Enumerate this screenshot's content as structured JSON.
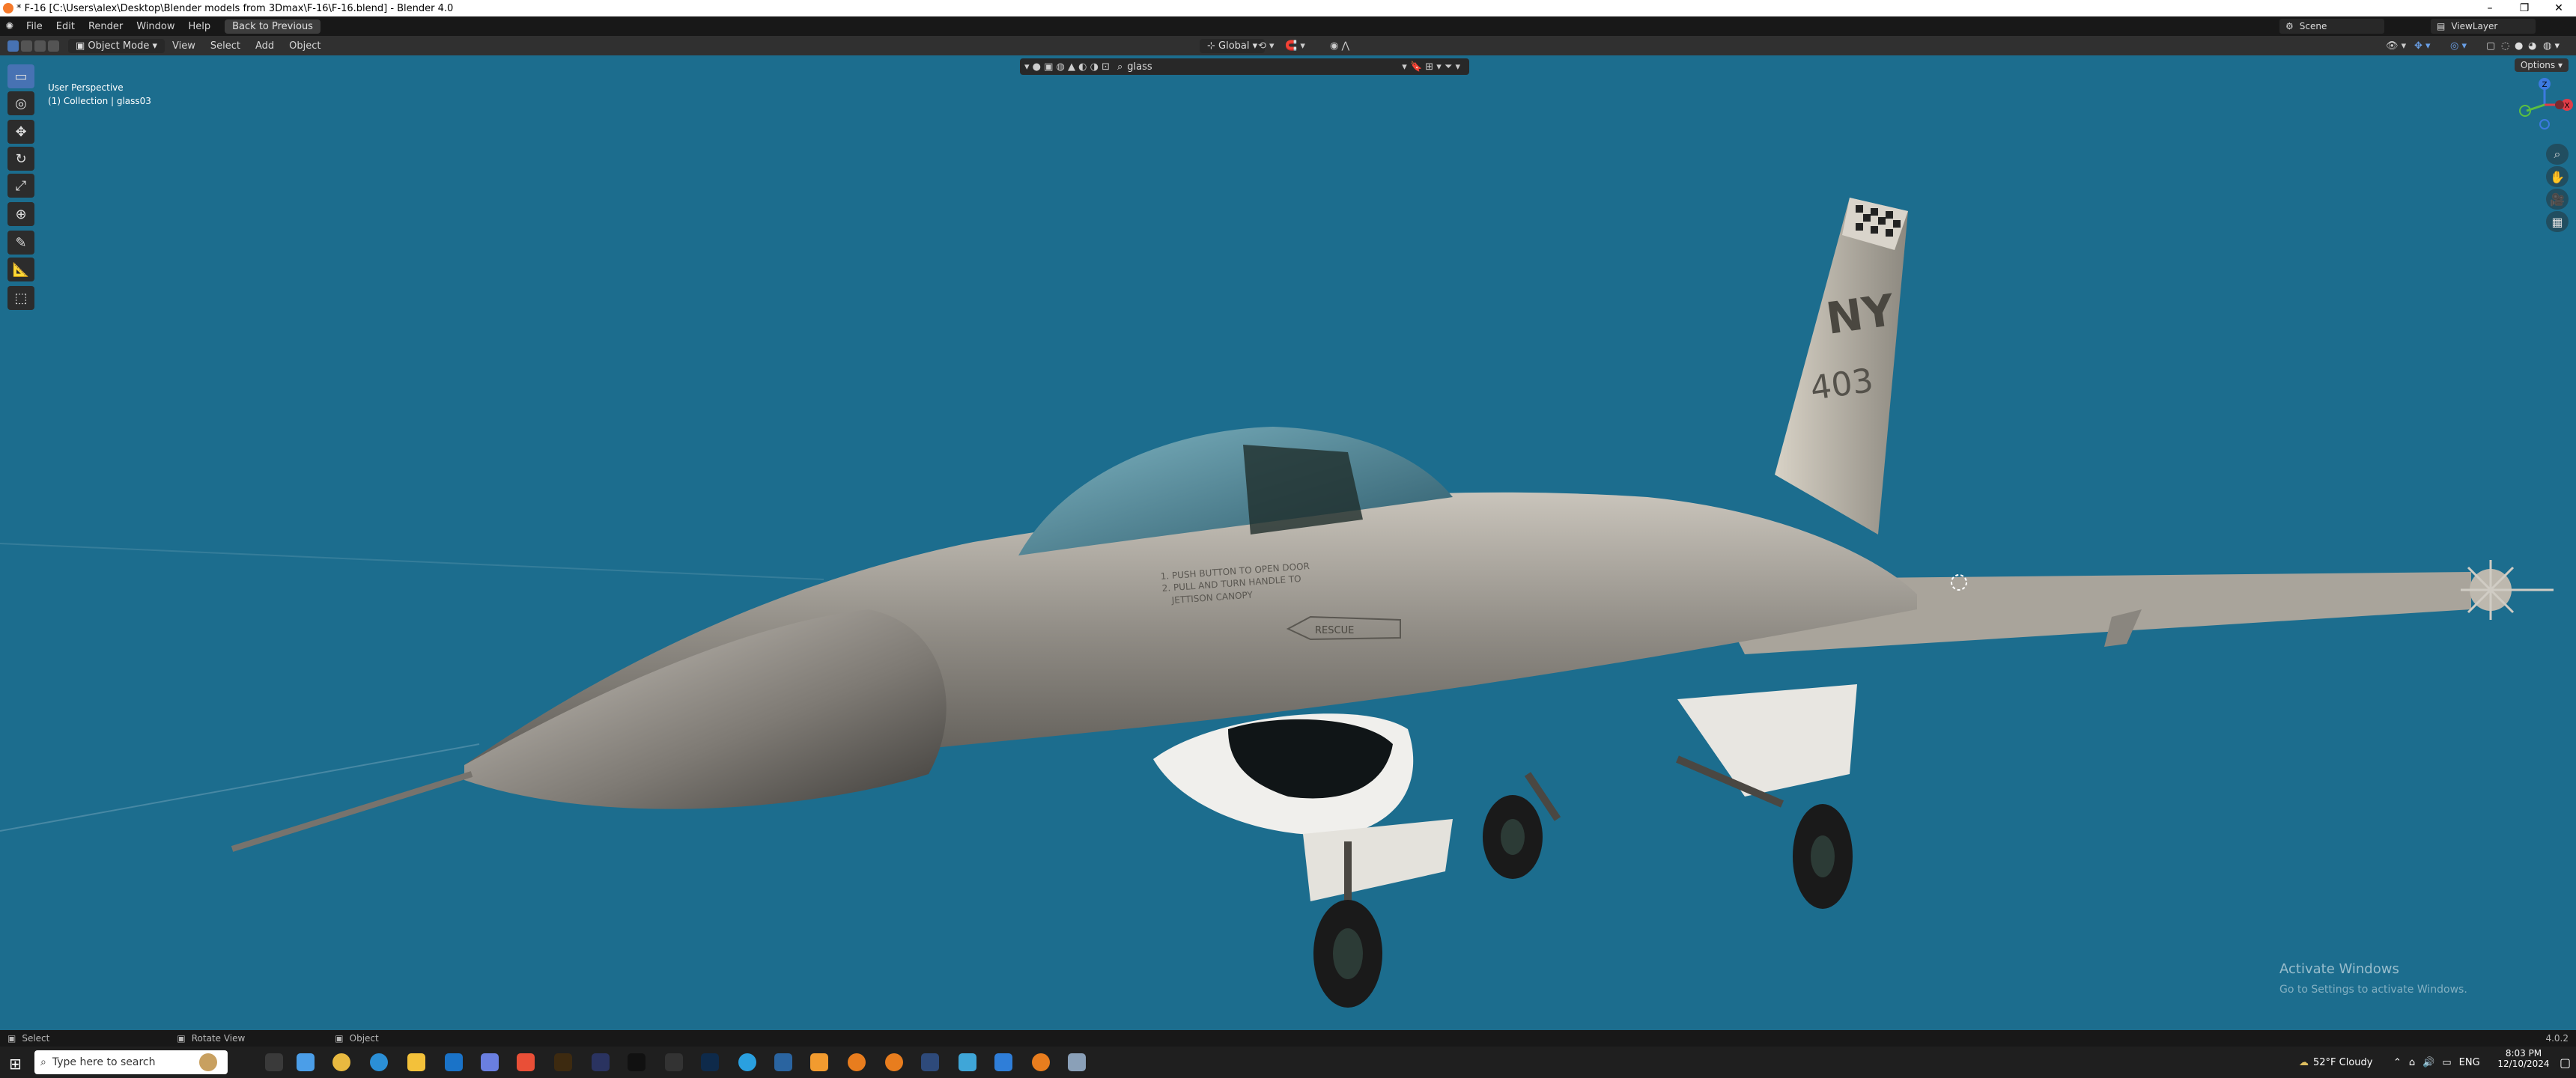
{
  "window": {
    "title": "* F-16 [C:\\Users\\alex\\Desktop\\Blender models from 3Dmax\\F-16\\F-16.blend] - Blender 4.0",
    "controls": {
      "minimize": "–",
      "maximize": "❐",
      "close": "✕"
    }
  },
  "menu": {
    "items": [
      "File",
      "Edit",
      "Render",
      "Window",
      "Help"
    ],
    "back_button": "Back to Previous",
    "scene": "Scene",
    "view_layer": "ViewLayer"
  },
  "header": {
    "mode": "Object Mode",
    "items": [
      "View",
      "Select",
      "Add",
      "Object"
    ],
    "transform_orientation": "Global",
    "options": "Options"
  },
  "viewport": {
    "perspective": "User Perspective",
    "collection": "(1) Collection | glass03",
    "search_value": "glass",
    "background_color": "#1c6d8e"
  },
  "tools": [
    {
      "name": "select-box-tool",
      "icon": "▭"
    },
    {
      "name": "cursor-tool",
      "icon": "◎"
    },
    {
      "name": "move-tool",
      "icon": "✥"
    },
    {
      "name": "rotate-tool",
      "icon": "↻"
    },
    {
      "name": "scale-tool",
      "icon": "⤢"
    },
    {
      "name": "transform-tool",
      "icon": "⊕"
    },
    {
      "name": "annotate-tool",
      "icon": "✎"
    },
    {
      "name": "measure-tool",
      "icon": "📐"
    },
    {
      "name": "add-cube-tool",
      "icon": "⬚"
    }
  ],
  "gizmo": {
    "x": "X",
    "y": "Y",
    "z": "Z"
  },
  "aircraft": {
    "tail_code": "NY",
    "tail_number": "403",
    "rescue": "RESCUE",
    "canopy_text": [
      "1. PUSH BUTTON TO OPEN DOOR",
      "2. PULL AND TURN HANDLE TO",
      "JETTISON CANOPY"
    ]
  },
  "watermark": {
    "line1": "Activate Windows",
    "line2": "Go to Settings to activate Windows."
  },
  "statusbar": {
    "select": "Select",
    "rotate": "Rotate View",
    "object": "Object",
    "version": "4.0.2"
  },
  "taskbar": {
    "search_placeholder": "Type here to search",
    "weather": "52°F  Cloudy",
    "lang": "ENG",
    "time": "8:03 PM",
    "date": "12/10/2024"
  }
}
